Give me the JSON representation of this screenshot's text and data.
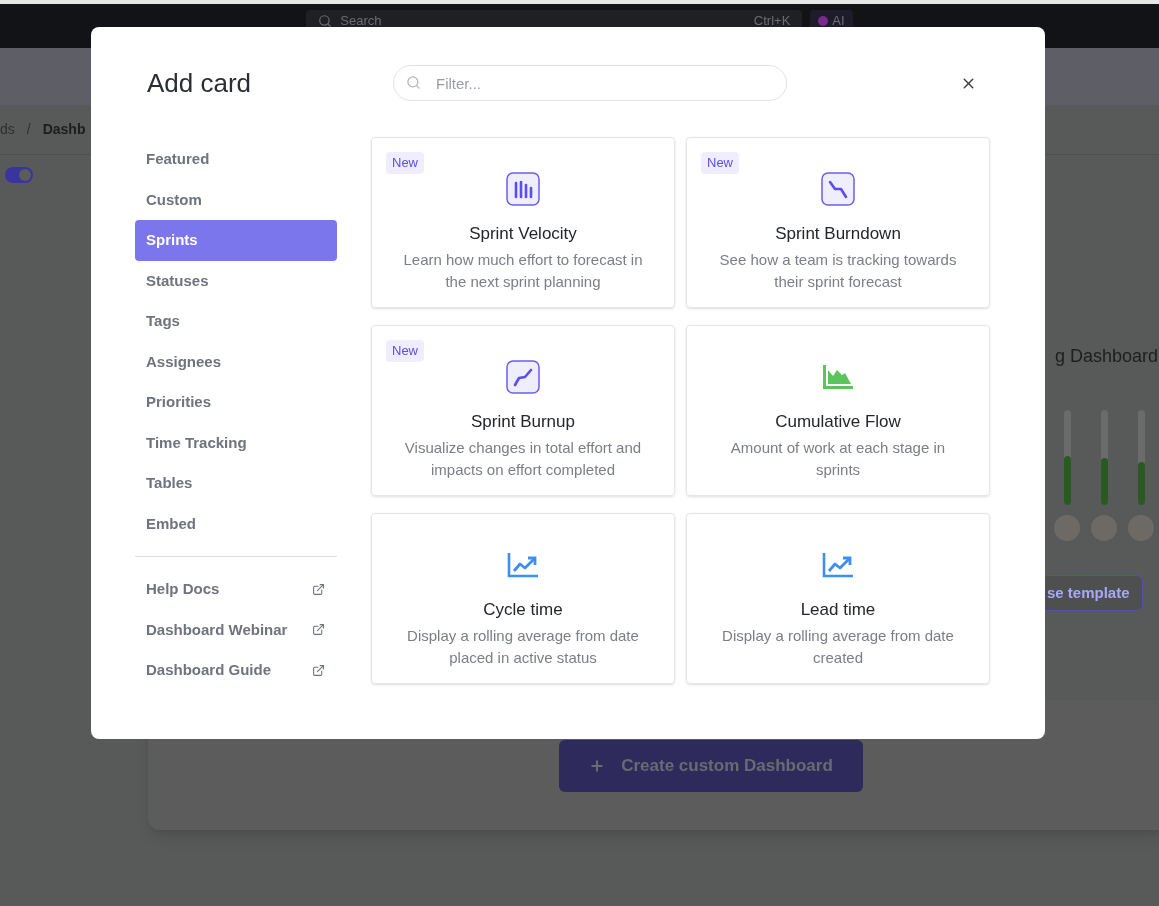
{
  "background": {
    "search_placeholder": "Search",
    "shortcut": "Ctrl+K",
    "ai_label": "AI",
    "breadcrumb": [
      "ds",
      "Dashb"
    ],
    "separator": "/",
    "toggle_on": true,
    "template_title": "g Dashboard",
    "bars": [
      {
        "level": 0.52
      },
      {
        "level": 0.5
      },
      {
        "level": 0.45
      }
    ],
    "template_button": "se template",
    "create_button": "Create custom Dashboard"
  },
  "modal": {
    "title": "Add card",
    "filter": {
      "placeholder": "Filter..."
    },
    "nav": [
      {
        "label": "Featured",
        "selected": false
      },
      {
        "label": "Custom",
        "selected": false
      },
      {
        "label": "Sprints",
        "selected": true
      },
      {
        "label": "Statuses",
        "selected": false
      },
      {
        "label": "Tags",
        "selected": false
      },
      {
        "label": "Assignees",
        "selected": false
      },
      {
        "label": "Priorities",
        "selected": false
      },
      {
        "label": "Time Tracking",
        "selected": false
      },
      {
        "label": "Tables",
        "selected": false
      },
      {
        "label": "Embed",
        "selected": false
      }
    ],
    "links": [
      {
        "label": "Help Docs"
      },
      {
        "label": "Dashboard Webinar"
      },
      {
        "label": "Dashboard Guide"
      }
    ],
    "cards": [
      {
        "kind": "velocity",
        "badge": "New",
        "title": "Sprint Velocity",
        "description": "Learn how much effort to forecast in the next sprint planning"
      },
      {
        "kind": "burndown",
        "badge": "New",
        "title": "Sprint Burndown",
        "description": "See how a team is tracking towards their sprint forecast"
      },
      {
        "kind": "burnup",
        "badge": "New",
        "title": "Sprint Burnup",
        "description": "Visualize changes in total effort and impacts on effort completed"
      },
      {
        "kind": "cumulative",
        "title": "Cumulative Flow",
        "description": "Amount of work at each stage in sprints"
      },
      {
        "kind": "trend",
        "title": "Cycle time",
        "description": "Display a rolling average from date placed in active status"
      },
      {
        "kind": "trend",
        "title": "Lead time",
        "description": "Display a rolling average from date created"
      }
    ]
  }
}
